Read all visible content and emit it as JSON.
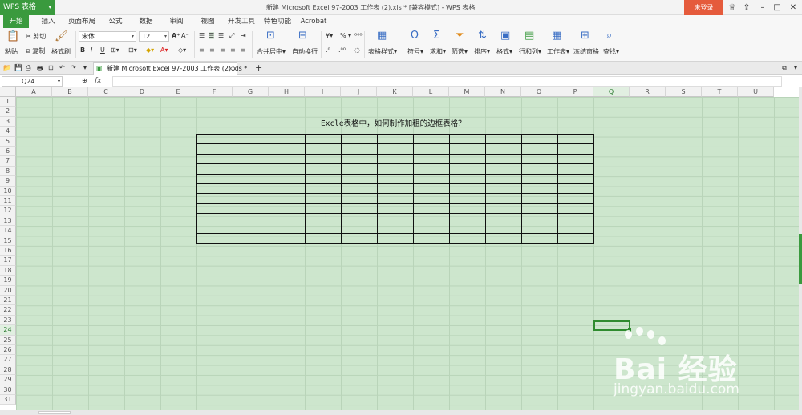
{
  "titlebar": {
    "app_name": "WPS 表格",
    "title": "新建 Microsoft Excel 97-2003 工作表 (2).xls * [兼容模式] - WPS 表格",
    "login": "未登录"
  },
  "menu_tabs": [
    "开始",
    "插入",
    "页面布局",
    "公式",
    "数据",
    "审阅",
    "视图",
    "开发工具",
    "特色功能",
    "Acrobat"
  ],
  "ribbon": {
    "paste": "粘贴",
    "cut": "剪切",
    "copy": "复制",
    "format_painter": "格式刷",
    "font_name": "宋体",
    "font_size": "12",
    "bold": "B",
    "italic": "I",
    "underline": "U",
    "merge_center": "合并居中",
    "wrap_text": "自动换行",
    "table_style": "表格样式",
    "symbol": "符号",
    "sum": "求和",
    "filter": "筛选",
    "sort": "排序",
    "format": "格式",
    "rows_cols": "行和列",
    "worksheet": "工作表",
    "freeze": "冻结窗格",
    "find": "查找",
    "percent": "%"
  },
  "document_tab": {
    "label": "新建 Microsoft Excel 97-2003 工作表 (2).xls *",
    "close": "×",
    "add": "+"
  },
  "formula_bar": {
    "name_box": "Q24",
    "fx": "fx",
    "value": ""
  },
  "grid": {
    "columns": [
      "A",
      "B",
      "C",
      "D",
      "E",
      "F",
      "G",
      "H",
      "I",
      "J",
      "K",
      "L",
      "M",
      "N",
      "O",
      "P",
      "Q",
      "R",
      "S",
      "T",
      "U"
    ],
    "rows": [
      "1",
      "2",
      "3",
      "4",
      "5",
      "6",
      "7",
      "8",
      "9",
      "10",
      "11",
      "12",
      "13",
      "14",
      "15",
      "16",
      "17",
      "18",
      "19",
      "20",
      "21",
      "22",
      "23",
      "24",
      "25",
      "26",
      "27",
      "28",
      "29",
      "30",
      "31"
    ],
    "selected_column": "Q",
    "selected_row": "24",
    "title_cell": "Excle表格中，如何制作加粗的边框表格？",
    "table_rows": 11,
    "table_cols": 11
  },
  "watermark": {
    "brand": "Bai 经验",
    "url": "jingyan.baidu.com"
  }
}
